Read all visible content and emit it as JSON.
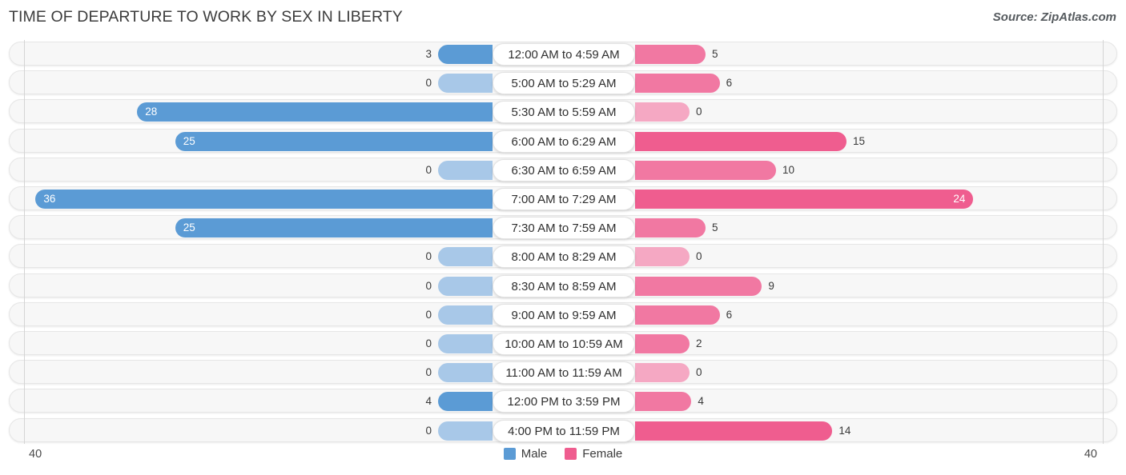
{
  "header": {
    "title": "TIME OF DEPARTURE TO WORK BY SEX IN LIBERTY",
    "source": "Source: ZipAtlas.com"
  },
  "legend": {
    "items": [
      {
        "label": "Male",
        "color": "#5b9bd5"
      },
      {
        "label": "Female",
        "color": "#ef5d8f"
      }
    ]
  },
  "axis": {
    "left_tick": "40",
    "right_tick": "40"
  },
  "colors": {
    "male_strong": "#5b9bd5",
    "male_light": "#a8c8e8",
    "female_strong": "#ef5d8f",
    "female_mid": "#f178a2",
    "female_light": "#f5a8c3",
    "track": "#f7f7f7",
    "track_border": "#e6e6e6"
  },
  "chart_data": {
    "type": "bar",
    "orientation": "horizontal",
    "style": "diverging-bidirectional",
    "title": "TIME OF DEPARTURE TO WORK BY SEX IN LIBERTY",
    "xlabel": "",
    "ylabel": "",
    "xlim": [
      -40,
      40
    ],
    "axis_max": 40,
    "grid": false,
    "legend_position": "bottom-center",
    "categories": [
      "12:00 AM to 4:59 AM",
      "5:00 AM to 5:29 AM",
      "5:30 AM to 5:59 AM",
      "6:00 AM to 6:29 AM",
      "6:30 AM to 6:59 AM",
      "7:00 AM to 7:29 AM",
      "7:30 AM to 7:59 AM",
      "8:00 AM to 8:29 AM",
      "8:30 AM to 8:59 AM",
      "9:00 AM to 9:59 AM",
      "10:00 AM to 10:59 AM",
      "11:00 AM to 11:59 AM",
      "12:00 PM to 3:59 PM",
      "4:00 PM to 11:59 PM"
    ],
    "series": [
      {
        "name": "Male",
        "values": [
          3,
          0,
          28,
          25,
          0,
          36,
          25,
          0,
          0,
          0,
          0,
          0,
          4,
          0
        ]
      },
      {
        "name": "Female",
        "values": [
          5,
          6,
          0,
          15,
          10,
          24,
          5,
          0,
          9,
          6,
          2,
          0,
          4,
          14
        ]
      }
    ]
  },
  "rows": [
    {
      "label": "12:00 AM to 4:59 AM",
      "male": "3",
      "female": "5"
    },
    {
      "label": "5:00 AM to 5:29 AM",
      "male": "0",
      "female": "6"
    },
    {
      "label": "5:30 AM to 5:59 AM",
      "male": "28",
      "female": "0"
    },
    {
      "label": "6:00 AM to 6:29 AM",
      "male": "25",
      "female": "15"
    },
    {
      "label": "6:30 AM to 6:59 AM",
      "male": "0",
      "female": "10"
    },
    {
      "label": "7:00 AM to 7:29 AM",
      "male": "36",
      "female": "24"
    },
    {
      "label": "7:30 AM to 7:59 AM",
      "male": "25",
      "female": "5"
    },
    {
      "label": "8:00 AM to 8:29 AM",
      "male": "0",
      "female": "0"
    },
    {
      "label": "8:30 AM to 8:59 AM",
      "male": "0",
      "female": "9"
    },
    {
      "label": "9:00 AM to 9:59 AM",
      "male": "0",
      "female": "6"
    },
    {
      "label": "10:00 AM to 10:59 AM",
      "male": "0",
      "female": "2"
    },
    {
      "label": "11:00 AM to 11:59 AM",
      "male": "0",
      "female": "0"
    },
    {
      "label": "12:00 PM to 3:59 PM",
      "male": "4",
      "female": "4"
    },
    {
      "label": "4:00 PM to 11:59 PM",
      "male": "0",
      "female": "14"
    }
  ]
}
